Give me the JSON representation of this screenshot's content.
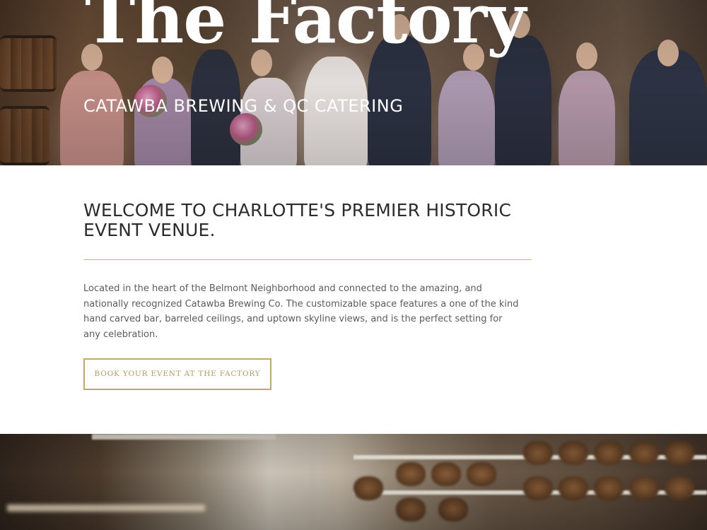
{
  "hero": {
    "title": "The Factory",
    "subtitle": "CATAWBA BREWING & QC CATERING"
  },
  "intro": {
    "heading": "WELCOME TO CHARLOTTE'S PREMIER HISTORIC EVENT VENUE.",
    "body": "Located in the heart of the Belmont Neighborhood and connected to the amazing, and nationally recognized Catawba Brewing Co. The customizable space features a one of the kind hand carved bar, barreled ceilings, and uptown skyline views, and is the perfect setting for any celebration.",
    "cta_label": "BOOK YOUR EVENT AT THE FACTORY"
  },
  "colors": {
    "accent_gold": "#c2a867",
    "heading_text": "#2c2c2c",
    "body_text": "#5b5b5b"
  }
}
